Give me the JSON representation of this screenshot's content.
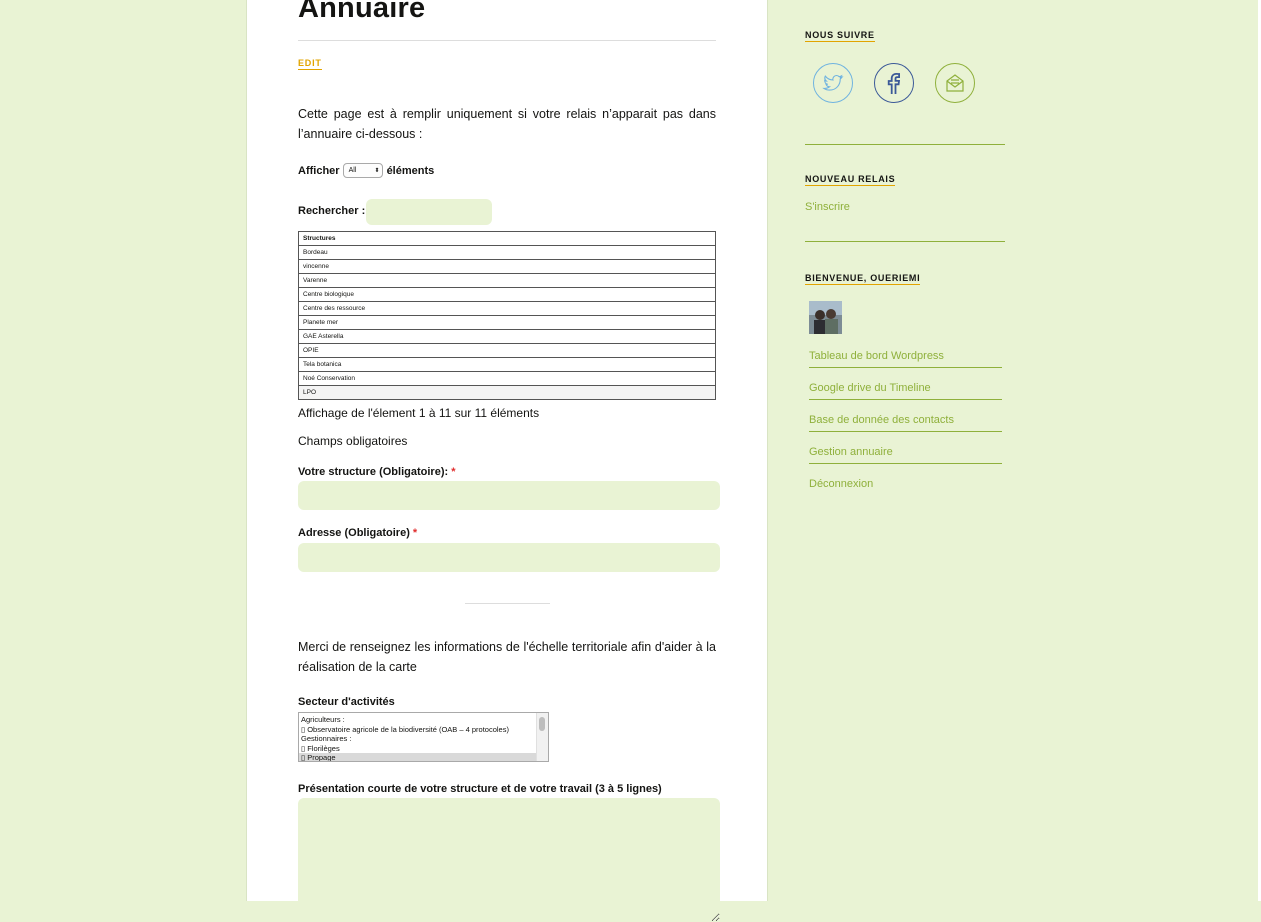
{
  "main": {
    "title": "Annuaire",
    "edit_label": "EDIT",
    "intro": "Cette page est à remplir uniquement si votre relais n’apparait pas dans l’annuaire ci-dessous :",
    "show_prefix": "Afficher",
    "show_value": "All",
    "show_suffix": "éléments",
    "search_label": "Rechercher :",
    "table": {
      "header": "Structures",
      "rows": [
        "Bordeau",
        "vincenne",
        "Varenne",
        "Centre biologique",
        "Centre des ressource",
        "Planete mer",
        "GAE Asterella",
        "OPIE",
        "Tela botanica",
        "Noé Conservation",
        "LPO"
      ]
    },
    "table_info": "Affichage de l'élement 1 à 11 sur 11 éléments",
    "required_note": "Champs obligatoires",
    "field_structure_label": "Votre structure (Obligatoire):",
    "field_address_label": "Adresse (Obligatoire)",
    "required_mark": "*",
    "merci": "Merci de renseignez les informations de l'échelle territoriale afin d'aider à la réalisation de la carte",
    "sector_label": "Secteur d'activités",
    "sector_options": [
      "Agriculteurs :",
      "▯ Observatoire agricole de la biodiversité (OAB – 4 protocoles)",
      "Gestionnaires :",
      "▯ Florilèges",
      "▯ Propage"
    ],
    "presentation_label": "Présentation courte de votre structure et de votre travail (3 à 5 lignes)"
  },
  "sidebar": {
    "follow_title": "NOUS SUIVRE",
    "social_icons": [
      "twitter-icon",
      "facebook-icon",
      "mail-icon"
    ],
    "new_relay_title": "NOUVEAU RELAIS",
    "signup_link": "S'inscrire",
    "welcome_title": "BIENVENUE, OUERIEMI",
    "menu": [
      "Tableau de bord Wordpress",
      "Google drive du Timeline",
      "Base de donnée des contacts",
      "Gestion annuaire",
      "Déconnexion"
    ]
  },
  "colors": {
    "background": "#e9f3d4",
    "accent_green": "#8fb03b",
    "accent_yellow": "#e2a400",
    "required_red": "#e02d2d",
    "twitter": "#6fb3e0",
    "facebook": "#3b5998"
  }
}
